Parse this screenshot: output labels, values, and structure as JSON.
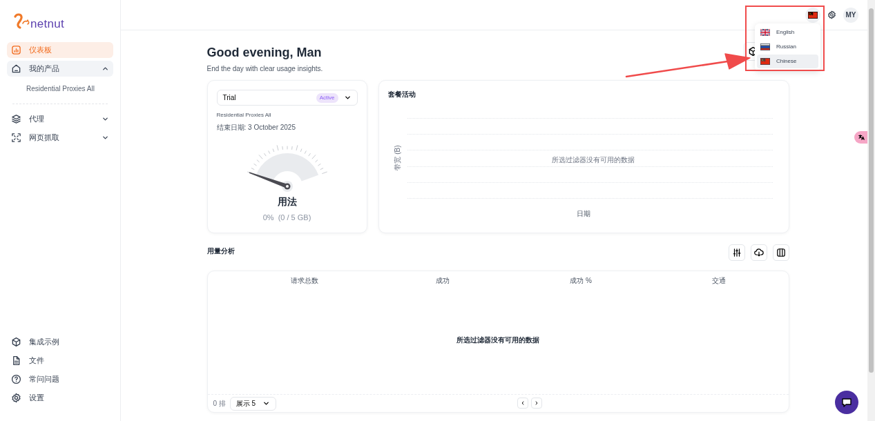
{
  "sidebar": {
    "logo": "netnut",
    "nav": [
      {
        "label": "仪表板",
        "kind": "dashboard",
        "selected": true
      },
      {
        "label": "我的产品",
        "kind": "products",
        "selected": false,
        "expanded": true,
        "children": [
          {
            "label": "Residential Proxies All",
            "selected": false
          }
        ]
      },
      {
        "label": "代理",
        "kind": "proxy",
        "selected": false,
        "expanded": false
      },
      {
        "label": "网页抓取",
        "kind": "scraping",
        "selected": false,
        "expanded": false
      }
    ],
    "bottom_nav": [
      {
        "label": "集成示例",
        "kind": "integration"
      },
      {
        "label": "文件",
        "kind": "docs"
      },
      {
        "label": "常问问题",
        "kind": "faq"
      },
      {
        "label": "设置",
        "kind": "settings"
      }
    ]
  },
  "header": {
    "avatar": "MY"
  },
  "language_menu": [
    {
      "label": "English",
      "kind": "uk",
      "selected": false
    },
    {
      "label": "Russian",
      "kind": "ru",
      "selected": false
    },
    {
      "label": "Chinese",
      "kind": "cn",
      "selected": true
    }
  ],
  "greeting": {
    "title": "Good evening, Man",
    "subtitle": "End the day with clear usage insights."
  },
  "plan_card": {
    "plan": "Trial",
    "status": "Active",
    "product": "Residential Proxies All",
    "end_date": "结束日期: 3 October 2025",
    "usage_title": "用法",
    "usage": "0%  (0 / 5 GB)"
  },
  "activity": {
    "title": "套餐活动",
    "ylabel": "带宽 (B)",
    "xlabel": "日期",
    "empty": "所选过滤器没有可用的数据"
  },
  "usage_analysis": {
    "title": "用量分析",
    "columns": [
      "请求总数",
      "成功",
      "成功 %",
      "交通"
    ],
    "empty": "所选过滤器没有可用的数据",
    "rows_label": "0 排",
    "page_size": "展示 5"
  }
}
